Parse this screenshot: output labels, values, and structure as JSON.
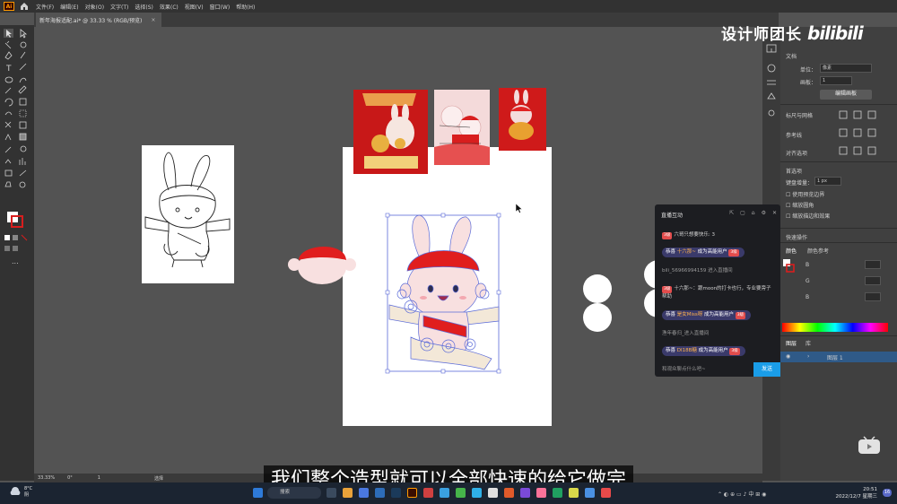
{
  "app": {
    "logo": "Ai",
    "home_icon": "home-icon"
  },
  "menu": [
    "文件(F)",
    "编辑(E)",
    "对象(O)",
    "文字(T)",
    "选择(S)",
    "效果(C)",
    "视图(V)",
    "窗口(W)",
    "帮助(H)"
  ],
  "document": {
    "tab_title": "新年海报适配.ai* @ 33.33 % (RGB/预览)",
    "close_label": "×"
  },
  "right_panel": {
    "section_title": "文档",
    "unit_label": "单位：",
    "unit_value": "像素",
    "artboard_label": "画板：",
    "artboard_value": "1",
    "edit_artboard_button": "编辑画板",
    "snap_label": "标尺与网格",
    "guides_label": "参考线",
    "align_label": "对齐选项",
    "prefs_label": "首选项",
    "keyboard_increment_label": "键盘增量：",
    "keyboard_increment_value": "1 px",
    "check_preview_bounds": "使用预览边界",
    "check_scale_corners": "缩放圆角",
    "check_scale_strokes": "缩放描边和效果",
    "quick_actions_label": "快速操作",
    "color_tab": "颜色",
    "color_ref_tab": "颜色参考",
    "channel_b": "B",
    "channel_g": "G",
    "channel_b2": "B",
    "layers_tab": "图层",
    "library_tab": "库",
    "layer_name": "图层 1"
  },
  "watermark": {
    "text": "设计师团长",
    "logo_text": "bilibili"
  },
  "live_chat": {
    "title": "直播互动",
    "messages": [
      {
        "badge": "3级",
        "text": "六哥只想要快乐: 3"
      },
      {
        "prefix": "恭喜",
        "name": "十六那~",
        "suffix": "成为高能用户",
        "badge": "3级"
      },
      {
        "text": "bili_56966994159 进入直播间"
      },
      {
        "badge": "3级",
        "text": "十六那~：跟moon的打卡也行，专业要旁子帮助"
      },
      {
        "prefix": "恭喜",
        "name": "是女Miss呀",
        "suffix": "成为高能用户",
        "badge": "3级"
      },
      {
        "text": "渔年春归_进入直播间"
      },
      {
        "prefix": "恭喜",
        "name": "DI18B糖",
        "suffix": "成为高能用户",
        "badge": "3级"
      }
    ],
    "input_placeholder": "和观众聊点什么吧~",
    "send_button": "发送"
  },
  "status_bar": {
    "zoom": "33.33%",
    "rotation": "0°",
    "artboard": "1",
    "tool": "选择"
  },
  "subtitle": "我们整个造型就可以全部快速的给它做完",
  "taskbar": {
    "weather_temp": "8°C",
    "weather_desc": "阴",
    "search_label": "搜索",
    "time": "20:51",
    "date": "2022/12/7 星期三",
    "notifications": "16"
  },
  "colors": {
    "accent_blue": "#1a9de8",
    "poster_red": "#d81e1e",
    "selection_blue": "#5a6ad8"
  }
}
